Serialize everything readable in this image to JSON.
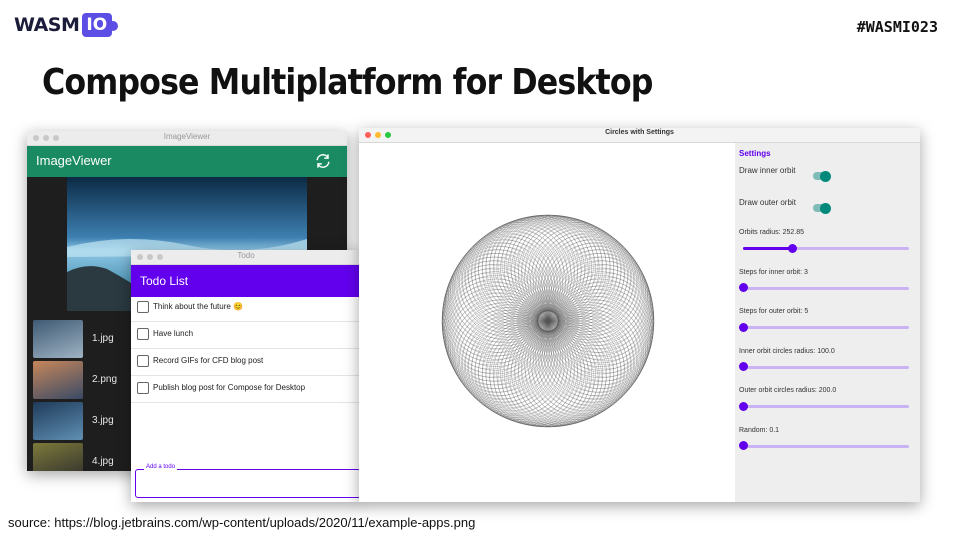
{
  "header": {
    "logo_text": "WASM",
    "logo_badge": "IO",
    "hashtag": "#WASMI023",
    "title": "Compose Multiplatform for Desktop"
  },
  "source": "source: https://blog.jetbrains.com/wp-content/uploads/2020/11/example-apps.png",
  "image_viewer": {
    "window_title": "ImageViewer",
    "app_title": "ImageViewer",
    "refresh_icon": "refresh-icon",
    "images": [
      {
        "name": "1.jpg",
        "thumb_colors": [
          "#3e5a73",
          "#9fb3c4"
        ]
      },
      {
        "name": "2.png",
        "thumb_colors": [
          "#c7875a",
          "#3a4a66"
        ]
      },
      {
        "name": "3.jpg",
        "thumb_colors": [
          "#1f3b5a",
          "#5f8fb3"
        ]
      },
      {
        "name": "4.jpg",
        "thumb_colors": [
          "#7d7a3a",
          "#2d2d2d"
        ]
      }
    ]
  },
  "todo": {
    "window_title": "Todo",
    "app_title": "Todo List",
    "items": [
      {
        "text": "Think about the future 😊"
      },
      {
        "text": "Have lunch"
      },
      {
        "text": "Record GIFs for CFD blog post"
      },
      {
        "text": "Publish blog post for Compose for Desktop"
      }
    ],
    "input_label": "Add a todo"
  },
  "circles": {
    "window_title": "Circles with Settings",
    "settings_title": "Settings",
    "toggles": [
      {
        "label": "Draw inner orbit",
        "on": true
      },
      {
        "label": "Draw outer orbit",
        "on": true
      }
    ],
    "sliders": [
      {
        "label": "Orbits radius: 252.85",
        "fraction": 0.3
      },
      {
        "label": "Steps for inner orbit: 3",
        "fraction": 0.0
      },
      {
        "label": "Steps for outer orbit: 5",
        "fraction": 0.0
      },
      {
        "label": "Inner orbit circles radius: 100.0",
        "fraction": 0.0
      },
      {
        "label": "Outer orbit circles radius: 200.0",
        "fraction": 0.0
      },
      {
        "label": "Random: 0.1",
        "fraction": 0.0
      }
    ],
    "colors": {
      "accent": "#6200ee",
      "switch": "#00897b"
    }
  }
}
